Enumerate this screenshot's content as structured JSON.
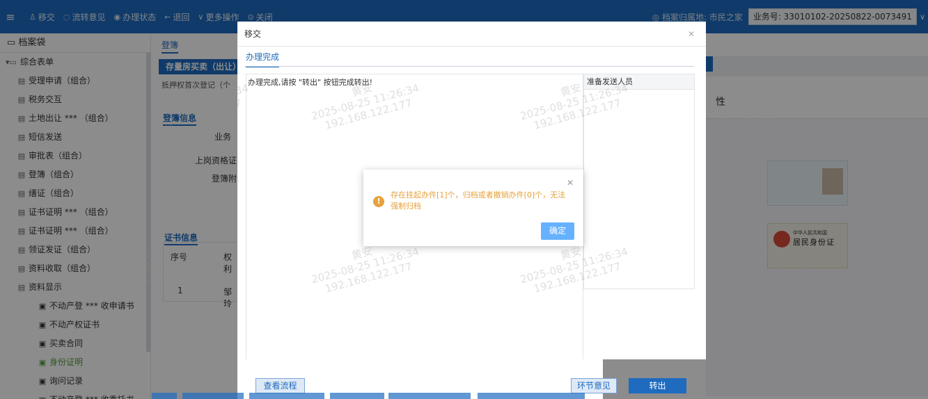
{
  "topbar": {
    "menu_icon": "hamburger-icon",
    "items": [
      {
        "icon": "person-icon",
        "label": "移交"
      },
      {
        "icon": "chat-icon",
        "label": "流转意见"
      },
      {
        "icon": "eye-icon",
        "label": "办理状态"
      },
      {
        "icon": "arrow-left-icon",
        "label": "退回"
      },
      {
        "icon": "chevron-down-icon",
        "label": "更多操作"
      },
      {
        "icon": "close-circle-icon",
        "label": "关闭"
      }
    ],
    "location": "◎ 档案归属地: 市民之家",
    "business_no": "业务号: 33010102-20250822-0073491"
  },
  "sidebar": {
    "title": "档案袋",
    "items": [
      {
        "label": "综合表单",
        "level": 0
      },
      {
        "label": "受理申请（组合）",
        "level": 1
      },
      {
        "label": "税务交互",
        "level": 1
      },
      {
        "label": "土地出让 *** （组合）",
        "level": 1
      },
      {
        "label": "短信发送",
        "level": 1
      },
      {
        "label": "审批表（组合）",
        "level": 1
      },
      {
        "label": "登簿（组合）",
        "level": 1
      },
      {
        "label": "缮证（组合）",
        "level": 1
      },
      {
        "label": "证书证明 *** （组合）",
        "level": 1
      },
      {
        "label": "证书证明 *** （组合）",
        "level": 1
      },
      {
        "label": "领证发证（组合）",
        "level": 1
      },
      {
        "label": "资料收取（组合）",
        "level": 1
      },
      {
        "label": "资料显示",
        "level": 1
      },
      {
        "label": "不动产登 *** 收申请书",
        "level": 2
      },
      {
        "label": "不动产权证书",
        "level": 2
      },
      {
        "label": "买卖合同",
        "level": 2
      },
      {
        "label": "身份证明",
        "level": 2,
        "active": true
      },
      {
        "label": "询问记录",
        "level": 2
      },
      {
        "label": "不动产登 *** 收委托书",
        "level": 2
      }
    ]
  },
  "main": {
    "tab": "登簿",
    "header": "存量房买卖（出让）",
    "subtab": "抵押权首次登记（个",
    "section1": "登簿信息",
    "labels": [
      "业务",
      "上岗资格证",
      "登簿附"
    ],
    "section2": "证书信息",
    "table_headers": [
      "序号",
      "权利"
    ],
    "table_row": [
      "1",
      "邹玲"
    ],
    "right_title": "性"
  },
  "modal": {
    "title": "移交",
    "tab": "办理完成",
    "message": "办理完成,请按 \"转出\" 按钮完成转出!",
    "receivers_header": "准备发送人员",
    "buttons": {
      "flow": "查看流程",
      "opinion": "环节意见",
      "transfer": "转出"
    }
  },
  "alert": {
    "message": "存在挂起办件[1]个，归档或者撤销办件[0]个，无法强制归档",
    "ok": "确定"
  },
  "idcard": {
    "country": "中华人民共和国",
    "title": "居民身份证"
  },
  "watermark": {
    "name": "黄安",
    "time": "2025-08-25 11:26:34",
    "ip": "192.168.122.177"
  }
}
